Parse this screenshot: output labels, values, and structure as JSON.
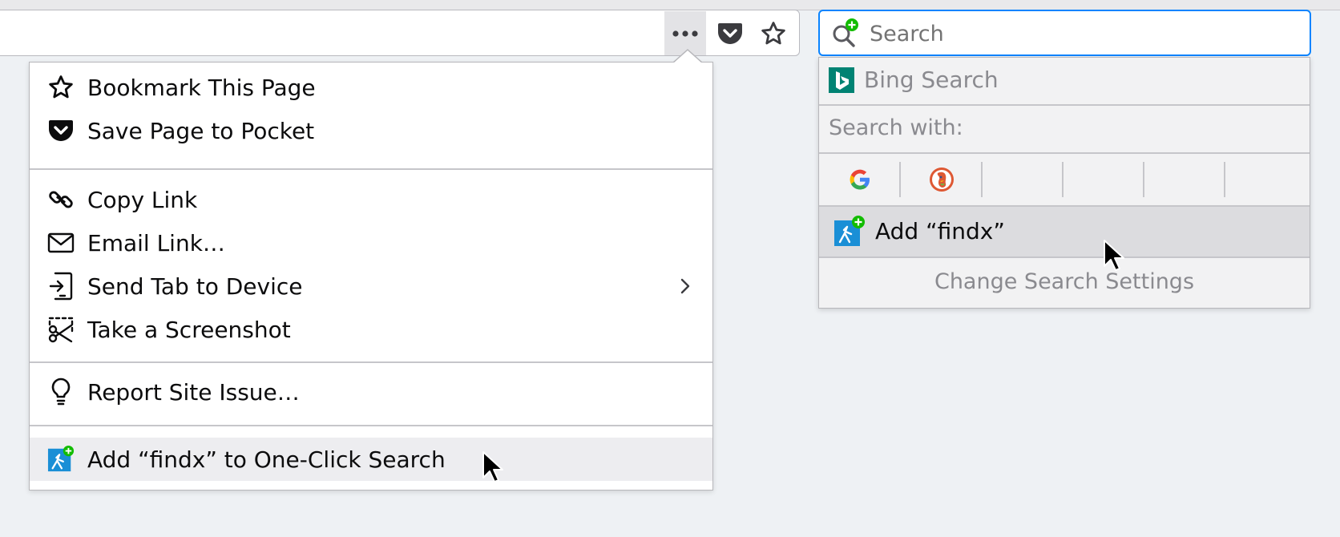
{
  "toolbar": {
    "search_placeholder": "Search"
  },
  "page_action_menu": {
    "items": [
      {
        "label": "Bookmark This Page",
        "icon": "star-icon"
      },
      {
        "label": "Save Page to Pocket",
        "icon": "pocket-icon"
      },
      {
        "label": "Copy Link",
        "icon": "link-icon"
      },
      {
        "label": "Email Link…",
        "icon": "envelope-icon"
      },
      {
        "label": "Send Tab to Device",
        "icon": "send-tab-icon",
        "submenu": true
      },
      {
        "label": "Take a Screenshot",
        "icon": "scissors-icon"
      },
      {
        "label": "Report Site Issue…",
        "icon": "lightbulb-icon"
      },
      {
        "label": "Add “findx” to One-Click Search",
        "icon": "findx-add-icon",
        "hovered": true
      }
    ]
  },
  "search_popup": {
    "current_engine": "Bing Search",
    "search_with_label": "Search with:",
    "one_off_engines": [
      "google-icon",
      "duckduckgo-icon",
      "",
      "",
      "",
      ""
    ],
    "add_engine_label": "Add “findx”",
    "settings_label": "Change Search Settings"
  },
  "colors": {
    "accent": "#0a84ff",
    "bing_teal": "#008373",
    "findx_blue": "#1a8fd6",
    "add_green": "#12bc00"
  }
}
